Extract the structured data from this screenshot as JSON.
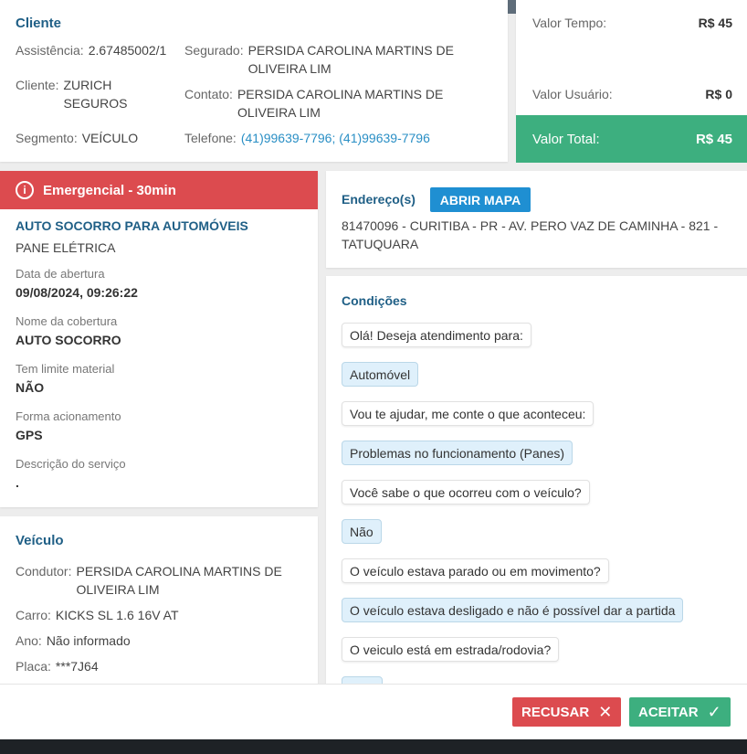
{
  "cliente": {
    "title": "Cliente",
    "assistencia_label": "Assistência:",
    "assistencia_value": "2.67485002/1",
    "segurado_label": "Segurado:",
    "segurado_value": "PERSIDA CAROLINA MARTINS DE OLIVEIRA LIM",
    "cliente_label": "Cliente:",
    "cliente_value": "ZURICH SEGUROS",
    "contato_label": "Contato:",
    "contato_value": "PERSIDA CAROLINA MARTINS DE OLIVEIRA LIM",
    "segmento_label": "Segmento:",
    "segmento_value": "VEÍCULO",
    "telefone_label": "Telefone:",
    "telefone_value": "(41)99639-7796; (41)99639-7796"
  },
  "valores": {
    "tempo_label": "Valor Tempo:",
    "tempo_value": "R$ 45",
    "usuario_label": "Valor Usuário:",
    "usuario_value": "R$ 0",
    "total_label": "Valor Total:",
    "total_value": "R$ 45"
  },
  "servico": {
    "alert_label": "Emergencial - 30min",
    "service_title": "AUTO SOCORRO PARA AUTOMÓVEIS",
    "service_subtitle": "PANE ELÉTRICA",
    "fields": [
      {
        "label": "Data de abertura",
        "value": "09/08/2024, 09:26:22"
      },
      {
        "label": "Nome da cobertura",
        "value": "AUTO SOCORRO"
      },
      {
        "label": "Tem limite material",
        "value": "NÃO"
      },
      {
        "label": "Forma acionamento",
        "value": "GPS"
      },
      {
        "label": "Descrição do serviço",
        "value": "."
      }
    ]
  },
  "veiculo": {
    "title": "Veículo",
    "condutor_label": "Condutor:",
    "condutor_value": "PERSIDA CAROLINA MARTINS DE OLIVEIRA LIM",
    "carro_label": "Carro:",
    "carro_value": "KICKS SL 1.6 16V AT",
    "ano_label": "Ano:",
    "ano_value": "Não informado",
    "placa_label": "Placa:",
    "placa_value": "***7J64"
  },
  "endereco": {
    "title": "Endereço(s)",
    "map_button": "ABRIR MAPA",
    "address": "81470096 - CURITIBA - PR - AV. PERO VAZ DE CAMINHA - 821 - TATUQUARA"
  },
  "condicoes": {
    "title": "Condições",
    "messages": [
      {
        "type": "bot",
        "text": "Olá! Deseja atendimento para:"
      },
      {
        "type": "user",
        "text": "Automóvel"
      },
      {
        "type": "bot",
        "text": "Vou te ajudar, me conte o que aconteceu:"
      },
      {
        "type": "user",
        "text": "Problemas no funcionamento (Panes)"
      },
      {
        "type": "bot",
        "text": "Você sabe o que ocorreu com o veículo?"
      },
      {
        "type": "user",
        "text": "Não"
      },
      {
        "type": "bot",
        "text": "O veículo estava parado ou em movimento?"
      },
      {
        "type": "user",
        "text": "O veículo estava desligado e não é possível dar a partida"
      },
      {
        "type": "bot",
        "text": "O veiculo está em estrada/rodovia?"
      }
    ]
  },
  "actions": {
    "recusar": "RECUSAR",
    "aceitar": "ACEITAR"
  },
  "colors": {
    "accent": "#1f5f86",
    "danger": "#dc4b4f",
    "success": "#3daf7f",
    "map_button": "#1f8fd2"
  }
}
